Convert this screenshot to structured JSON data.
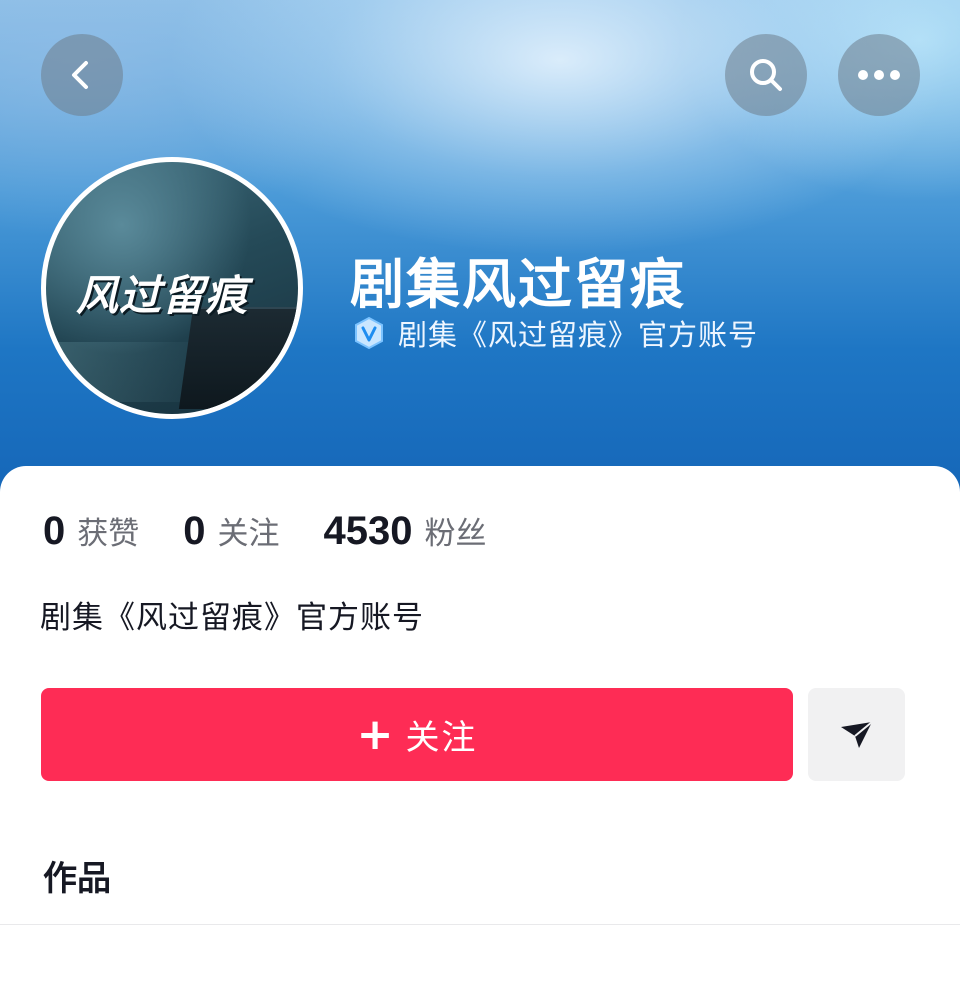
{
  "header": {
    "back_icon": "chevron-left-icon",
    "search_icon": "search-icon",
    "more_icon": "more-horizontal-icon"
  },
  "profile": {
    "avatar_title": "风过留痕",
    "name": "剧集风过留痕",
    "verified_icon": "verified-badge-icon",
    "verified_text": "剧集《风过留痕》官方账号"
  },
  "stats": [
    {
      "value": "0",
      "label": "获赞"
    },
    {
      "value": "0",
      "label": "关注"
    },
    {
      "value": "4530",
      "label": "粉丝"
    }
  ],
  "bio": "剧集《风过留痕》官方账号",
  "actions": {
    "follow_plus": "+",
    "follow_label": "关注",
    "share_icon": "send-arrow-icon"
  },
  "section": {
    "works_title": "作品"
  },
  "colors": {
    "follow_button": "#fe2c55",
    "share_button": "#f1f1f2",
    "hero_blue": "#1e76c4"
  }
}
